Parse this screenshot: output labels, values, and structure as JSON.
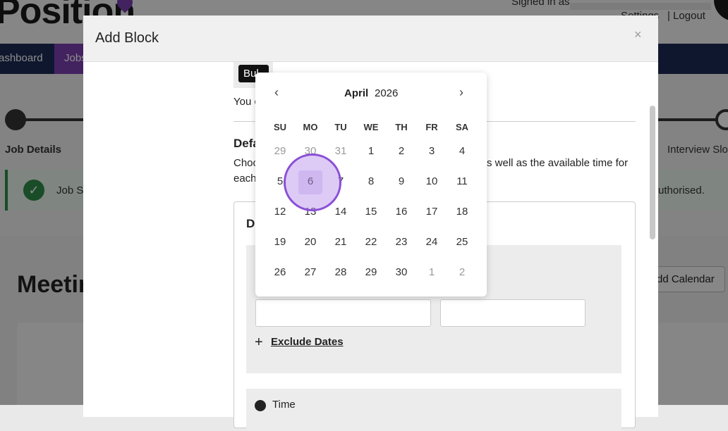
{
  "background": {
    "logo_text": "Position",
    "signed_in": "Signed in as",
    "settings_label": "Settings",
    "separator": "|",
    "logout_label": "Logout",
    "nav": {
      "dashboard": "ashboard",
      "jobs": "Jobs"
    },
    "steps": {
      "left": "Job Details",
      "right": "Interview Slo"
    },
    "alert": {
      "left": "Job S",
      "right": "uthorised."
    },
    "meeting_title": "Meetir",
    "add_calendar": "dd Calendar"
  },
  "modal": {
    "title": "Add Block",
    "close_label": "×",
    "bulk_label": "Bul",
    "you_text": "You c",
    "default_heading": "Defa",
    "choose_text": "Choo",
    "each_text": "each",
    "available_text": "s well as the available time for",
    "card_heading": "D",
    "exclude_plus": "+",
    "exclude_label": "Exclude Dates",
    "time_label": "Time"
  },
  "datepicker": {
    "month": "April",
    "year": "2026",
    "prev_label": "‹",
    "next_label": "›",
    "weekdays": [
      "SU",
      "MO",
      "TU",
      "WE",
      "TH",
      "FR",
      "SA"
    ],
    "weeks": [
      [
        "29",
        "30",
        "31",
        "1",
        "2",
        "3",
        "4"
      ],
      [
        "5",
        "6",
        "7",
        "8",
        "9",
        "10",
        "11"
      ],
      [
        "12",
        "13",
        "14",
        "15",
        "16",
        "17",
        "18"
      ],
      [
        "19",
        "20",
        "21",
        "22",
        "23",
        "24",
        "25"
      ],
      [
        "26",
        "27",
        "28",
        "29",
        "30",
        "1",
        "2"
      ]
    ],
    "selected_day": "6"
  },
  "colors": {
    "accent": "#7a3fb0",
    "navbar": "#1d2b55",
    "success": "#2e8b47"
  }
}
